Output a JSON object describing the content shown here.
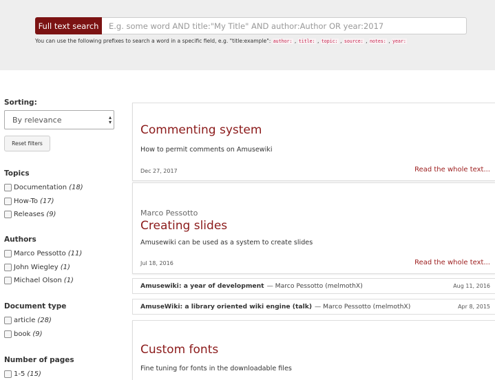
{
  "search": {
    "button_label": "Full text search",
    "placeholder": "E.g. some word AND title:\"My Title\" AND author:Author OR year:2017",
    "value": "",
    "help_text": "You can use the following prefixes to search a word in a specific field, e.g. \"title:example\": ",
    "prefixes": [
      "author:",
      "title:",
      "topic:",
      "source:",
      "notes:",
      "year:"
    ]
  },
  "sidebar": {
    "sorting_label": "Sorting:",
    "sorting_value": "By relevance",
    "reset_label": "Reset filters",
    "facets": [
      {
        "heading": "Topics",
        "items": [
          {
            "label": "Documentation",
            "count": "(18)"
          },
          {
            "label": "How-To",
            "count": "(17)"
          },
          {
            "label": "Releases",
            "count": "(9)"
          }
        ]
      },
      {
        "heading": "Authors",
        "items": [
          {
            "label": "Marco Pessotto",
            "count": "(11)"
          },
          {
            "label": "John Wiegley",
            "count": "(1)"
          },
          {
            "label": "Michael Olson",
            "count": "(1)"
          }
        ]
      },
      {
        "heading": "Document type",
        "items": [
          {
            "label": "article",
            "count": "(28)"
          },
          {
            "label": "book",
            "count": "(9)"
          }
        ]
      },
      {
        "heading": "Number of pages",
        "items": [
          {
            "label": "1-5",
            "count": "(15)"
          }
        ]
      }
    ]
  },
  "results": [
    {
      "title": "Commenting system",
      "author": "",
      "description": "How to permit comments on Amusewiki",
      "date": "Dec 27, 2017",
      "more": "Read the whole text..."
    },
    {
      "title": "Creating slides",
      "author": "Marco Pessotto",
      "description": "Amusewiki can be used as a system to create slides",
      "date": "Jul 18, 2016",
      "more": "Read the whole text..."
    },
    {
      "title": "Custom fonts",
      "author": "",
      "description": "Fine tuning for fonts in the downloadable files"
    }
  ],
  "rows": [
    {
      "title": "Amusewiki: a year of development",
      "author": "— Marco Pessotto (melmothX)",
      "date": "Aug 11, 2016"
    },
    {
      "title": "AmuseWiki: a library oriented wiki engine (talk)",
      "author": "— Marco Pessotto (melmothX)",
      "date": "Apr 8, 2015"
    }
  ]
}
